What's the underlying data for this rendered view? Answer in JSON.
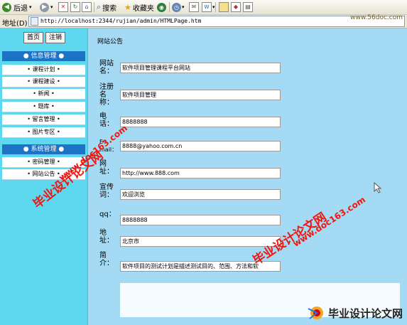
{
  "toolbar": {
    "back": "后退",
    "search": "搜索",
    "favorites": "收藏夹"
  },
  "address": {
    "label": "地址(D)",
    "url": "http://localhost:2344/rujian/admin/HTMLPage.htm"
  },
  "nav": {
    "home": "首页",
    "logout": "注销",
    "info_section": "● 信息管理 ●",
    "info_items": [
      "• 课程计划 •",
      "• 课程建设 •",
      "• 新闻 •",
      "• 题库 •",
      "• 留言管理 •",
      "• 图片专区 •"
    ],
    "sys_section": "● 系统管理 ●",
    "sys_items": [
      "• 密码管理 •",
      "• 网站公告 •"
    ]
  },
  "main": {
    "title": "网站公告",
    "fields": [
      {
        "label": "网站名：",
        "value": "软件项目管理课程平台网站"
      },
      {
        "label": "注册名称：",
        "value": "软件项目管理"
      },
      {
        "label": "电话：",
        "value": "8888888"
      },
      {
        "label": "E-mail：",
        "value": "8888@yahoo.com.cn"
      },
      {
        "label": "网址：",
        "value": "http://www.888.com"
      },
      {
        "label": "宣传词：",
        "value": "欢迎浏览"
      },
      {
        "label": "qq：",
        "value": "8888888"
      },
      {
        "label": "地址：",
        "value": "北京市"
      },
      {
        "label": "简介：",
        "value": "软件项目的测试计划是描述测试目的、范围、方法和软"
      }
    ]
  },
  "watermark": {
    "cn": "毕业设计论文网",
    "url": "www.doc163.com",
    "brand": "毕业设计论文网",
    "brand_url": "www.56doc.com"
  },
  "colors": {
    "nav_bg": "#5ed8ef",
    "main_bg": "#a4daf3",
    "section_head": "#1c72c4",
    "watermark": "#f0160f"
  }
}
